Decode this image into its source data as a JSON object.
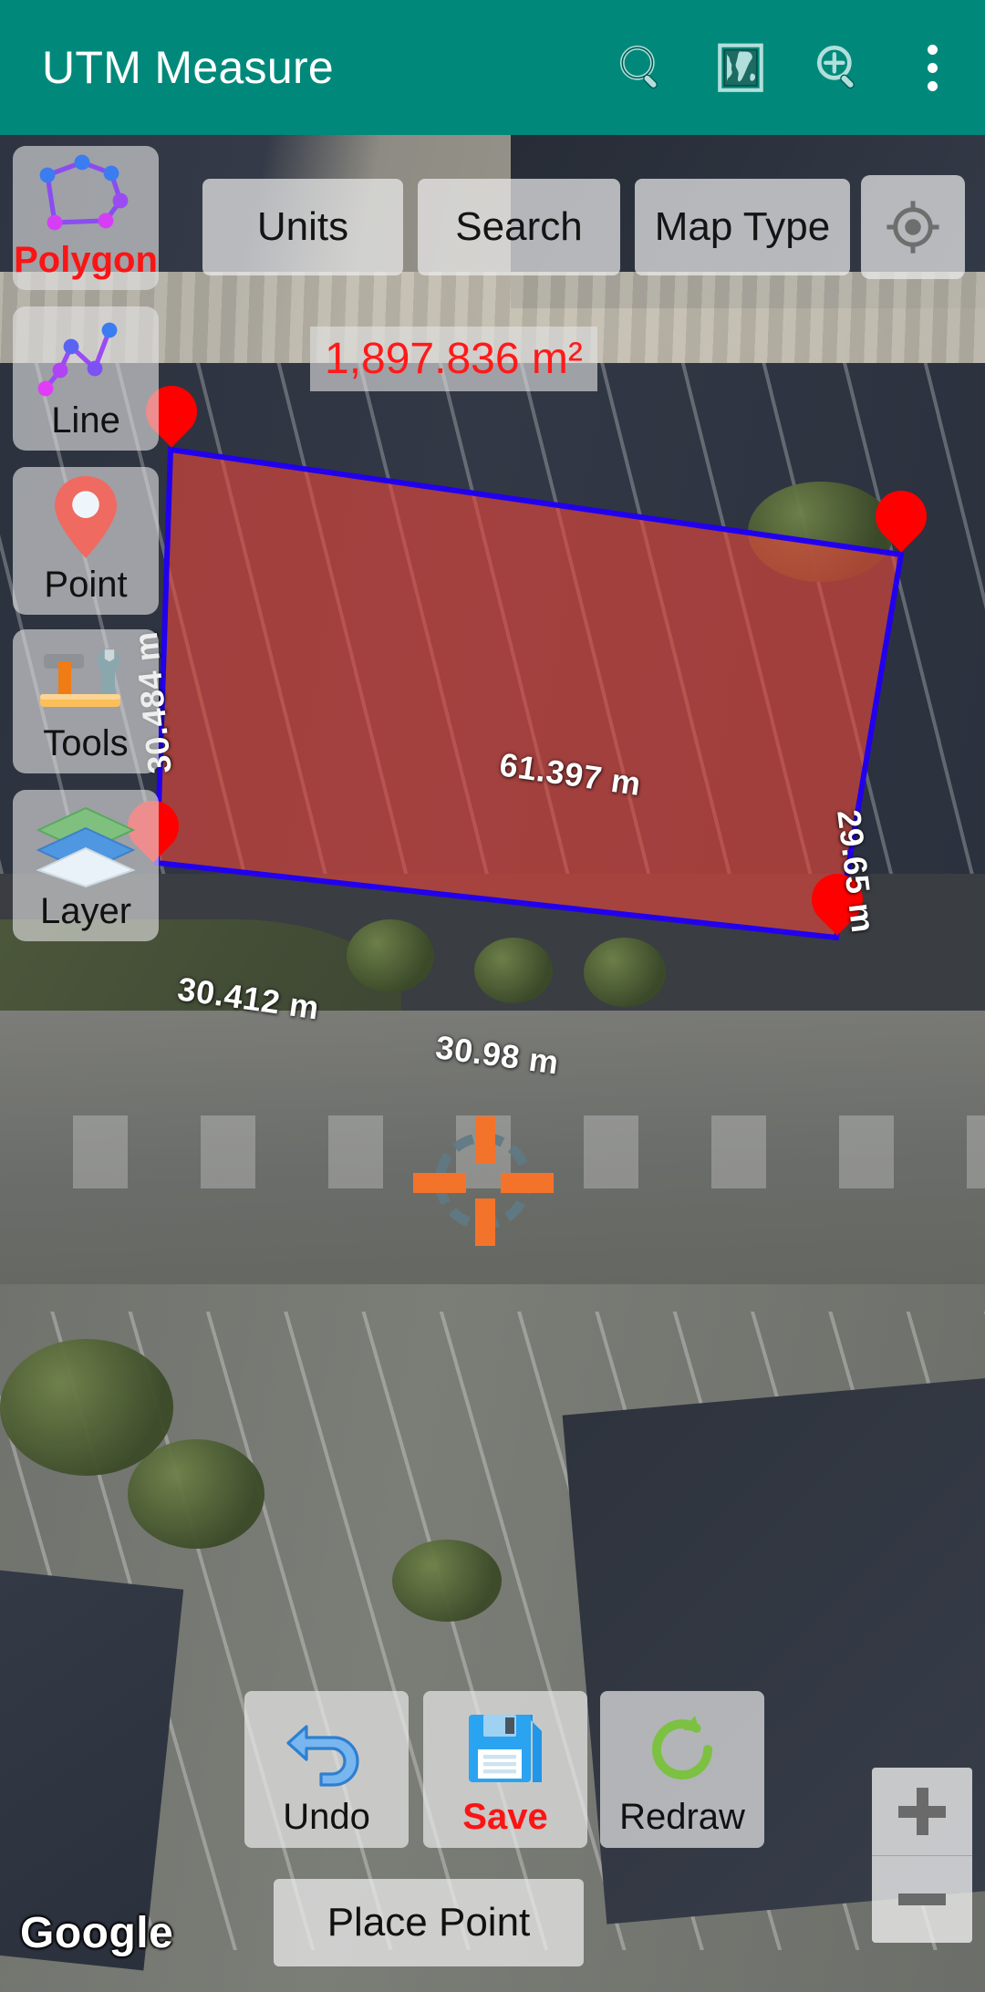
{
  "app": {
    "title": "UTM Measure",
    "bar_color": "#00897B",
    "actions": [
      {
        "name": "search-icon",
        "label": "Search"
      },
      {
        "name": "map-globe-icon",
        "label": "Map"
      },
      {
        "name": "zoom-search-icon",
        "label": "Zoom Search"
      },
      {
        "name": "overflow-menu-icon",
        "label": "More options"
      }
    ]
  },
  "top_toolbar": {
    "units_label": "Units",
    "search_label": "Search",
    "map_type_label": "Map Type",
    "my_location_icon": "gps-crosshair-icon"
  },
  "tool_rail": {
    "items": [
      {
        "label": "Polygon",
        "icon": "polygon-icon",
        "active": true
      },
      {
        "label": "Line",
        "icon": "polyline-icon",
        "active": false
      },
      {
        "label": "Point",
        "icon": "map-pin-icon",
        "active": false
      },
      {
        "label": "Tools",
        "icon": "tools-icon",
        "active": false
      },
      {
        "label": "Layer",
        "icon": "layers-icon",
        "active": false
      }
    ]
  },
  "measurement": {
    "area": "1,897.836 m²",
    "area_color": "#ff1a1a",
    "polygon_fill": "#e8473c",
    "polygon_stroke": "#2200ee",
    "edges": [
      {
        "id": "edge-top",
        "value": "61.397 m"
      },
      {
        "id": "edge-left",
        "value": "30.484 m"
      },
      {
        "id": "edge-right",
        "value": "29.65 m"
      },
      {
        "id": "edge-bottom-left",
        "value": "30.412 m"
      },
      {
        "id": "edge-bottom-right",
        "value": "30.98 m"
      }
    ],
    "vertex_markers": 4,
    "marker_color": "#fe0000",
    "crosshair_color": "#f4732b"
  },
  "bottom_bar": {
    "undo_label": "Undo",
    "save_label": "Save",
    "redraw_label": "Redraw",
    "place_point_label": "Place Point",
    "save_color": "#fb1414"
  },
  "zoom_controls": {
    "zoom_in": "+",
    "zoom_out": "−"
  },
  "attribution": {
    "text": "Google"
  }
}
